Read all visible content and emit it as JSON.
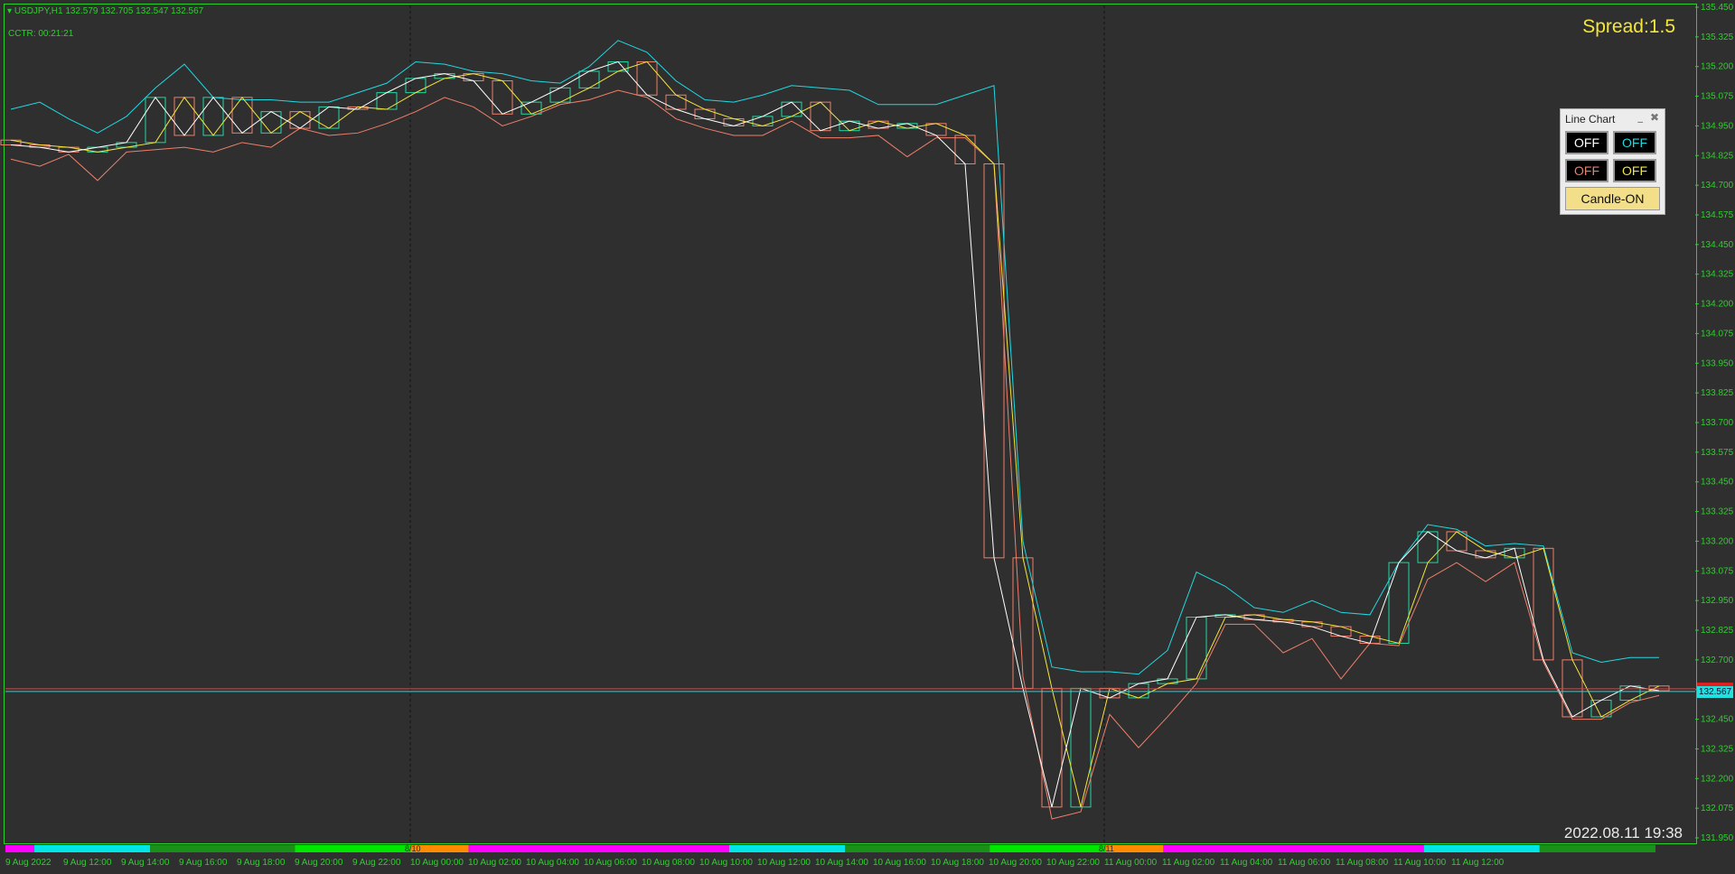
{
  "header": {
    "symbol_line": "USDJPY,H1  132.579 132.705 132.547 132.567",
    "timer": "CCTR: 00:21:21"
  },
  "spread": "Spread:1.5",
  "datetime": "2022.08.11 19:38",
  "bid_tag": "132.567",
  "panel": {
    "title": "Line Chart",
    "minimize": "_",
    "close": "✖",
    "buttons": [
      {
        "label": "OFF",
        "color": "#ffffff"
      },
      {
        "label": "OFF",
        "color": "#22d8e0"
      },
      {
        "label": "OFF",
        "color": "#ef7f6a"
      },
      {
        "label": "OFF",
        "color": "#f5e63c"
      }
    ],
    "candle_button": "Candle-ON"
  },
  "price_axis": [
    "135.450",
    "135.325",
    "135.200",
    "135.075",
    "134.950",
    "134.825",
    "134.700",
    "134.575",
    "134.450",
    "134.325",
    "134.200",
    "134.075",
    "133.950",
    "133.825",
    "133.700",
    "133.575",
    "133.450",
    "133.325",
    "133.200",
    "133.075",
    "132.950",
    "132.825",
    "132.700",
    "132.575",
    "132.450",
    "132.325",
    "132.200",
    "132.075",
    "131.950"
  ],
  "time_axis": [
    "9 Aug 2022",
    "9 Aug 12:00",
    "9 Aug 14:00",
    "9 Aug 16:00",
    "9 Aug 18:00",
    "9 Aug 20:00",
    "9 Aug 22:00",
    "10 Aug 00:00",
    "10 Aug 02:00",
    "10 Aug 04:00",
    "10 Aug 06:00",
    "10 Aug 08:00",
    "10 Aug 10:00",
    "10 Aug 12:00",
    "10 Aug 14:00",
    "10 Aug 16:00",
    "10 Aug 18:00",
    "10 Aug 20:00",
    "10 Aug 22:00",
    "11 Aug 00:00",
    "11 Aug 02:00",
    "11 Aug 04:00",
    "11 Aug 06:00",
    "11 Aug 08:00",
    "11 Aug 10:00",
    "11 Aug 12:00"
  ],
  "session_bar": {
    "day_labels": [
      "8/10",
      "8/11"
    ],
    "segments": [
      {
        "color": "#ff00ff",
        "weight": 1
      },
      {
        "color": "#00e5e5",
        "weight": 4
      },
      {
        "color": "#1a8f1a",
        "weight": 5
      },
      {
        "color": "#00e600",
        "weight": 4
      },
      {
        "color": "#ff8c00",
        "weight": 2
      },
      {
        "color": "#ff00ff",
        "weight": 9
      },
      {
        "color": "#00e5e5",
        "weight": 4
      },
      {
        "color": "#1a8f1a",
        "weight": 5
      },
      {
        "color": "#00e600",
        "weight": 4
      },
      {
        "color": "#ff8c00",
        "weight": 2
      },
      {
        "color": "#ff00ff",
        "weight": 9
      },
      {
        "color": "#00e5e5",
        "weight": 4
      },
      {
        "color": "#1a8f1a",
        "weight": 4
      }
    ]
  },
  "colors": {
    "high_line": "#22d8e0",
    "low_line": "#ef7f6a",
    "close_line": "#ffffff",
    "open_line": "#f5e63c",
    "bull_candle": "#22d8a0",
    "bear_candle": "#ef7f6a",
    "grid": "#2bd12b"
  },
  "chart_data": {
    "type": "candlestick",
    "symbol": "USDJPY",
    "timeframe": "H1",
    "ylim": [
      131.95,
      135.45
    ],
    "bid": 132.567,
    "candles": [
      {
        "o": 134.89,
        "h": 135.02,
        "l": 134.81,
        "c": 134.87
      },
      {
        "o": 134.87,
        "h": 135.05,
        "l": 134.78,
        "c": 134.86
      },
      {
        "o": 134.86,
        "h": 134.98,
        "l": 134.83,
        "c": 134.84
      },
      {
        "o": 134.84,
        "h": 134.92,
        "l": 134.72,
        "c": 134.86
      },
      {
        "o": 134.86,
        "h": 134.99,
        "l": 134.84,
        "c": 134.88
      },
      {
        "o": 134.88,
        "h": 135.11,
        "l": 134.85,
        "c": 135.07
      },
      {
        "o": 135.07,
        "h": 135.21,
        "l": 134.86,
        "c": 134.91
      },
      {
        "o": 134.91,
        "h": 135.07,
        "l": 134.84,
        "c": 135.07
      },
      {
        "o": 135.07,
        "h": 135.06,
        "l": 134.88,
        "c": 134.92
      },
      {
        "o": 134.92,
        "h": 135.06,
        "l": 134.86,
        "c": 135.01
      },
      {
        "o": 135.01,
        "h": 135.05,
        "l": 134.94,
        "c": 134.94
      },
      {
        "o": 134.94,
        "h": 135.05,
        "l": 134.91,
        "c": 135.03
      },
      {
        "o": 135.03,
        "h": 135.09,
        "l": 134.92,
        "c": 135.02
      },
      {
        "o": 135.02,
        "h": 135.13,
        "l": 134.96,
        "c": 135.09
      },
      {
        "o": 135.09,
        "h": 135.22,
        "l": 135.01,
        "c": 135.15
      },
      {
        "o": 135.15,
        "h": 135.21,
        "l": 135.07,
        "c": 135.17
      },
      {
        "o": 135.17,
        "h": 135.18,
        "l": 135.03,
        "c": 135.14
      },
      {
        "o": 135.14,
        "h": 135.17,
        "l": 134.95,
        "c": 135.0
      },
      {
        "o": 135.0,
        "h": 135.14,
        "l": 134.99,
        "c": 135.05
      },
      {
        "o": 135.05,
        "h": 135.13,
        "l": 135.04,
        "c": 135.11
      },
      {
        "o": 135.11,
        "h": 135.2,
        "l": 135.06,
        "c": 135.18
      },
      {
        "o": 135.18,
        "h": 135.31,
        "l": 135.1,
        "c": 135.22
      },
      {
        "o": 135.22,
        "h": 135.26,
        "l": 135.07,
        "c": 135.08
      },
      {
        "o": 135.08,
        "h": 135.14,
        "l": 134.98,
        "c": 135.02
      },
      {
        "o": 135.02,
        "h": 135.06,
        "l": 134.94,
        "c": 134.98
      },
      {
        "o": 134.98,
        "h": 135.05,
        "l": 134.91,
        "c": 134.95
      },
      {
        "o": 134.95,
        "h": 135.08,
        "l": 134.91,
        "c": 134.99
      },
      {
        "o": 134.99,
        "h": 135.12,
        "l": 134.97,
        "c": 135.05
      },
      {
        "o": 135.05,
        "h": 135.11,
        "l": 134.9,
        "c": 134.93
      },
      {
        "o": 134.93,
        "h": 135.1,
        "l": 134.9,
        "c": 134.97
      },
      {
        "o": 134.97,
        "h": 135.04,
        "l": 134.91,
        "c": 134.94
      },
      {
        "o": 134.94,
        "h": 135.04,
        "l": 134.82,
        "c": 134.96
      },
      {
        "o": 134.96,
        "h": 135.04,
        "l": 134.9,
        "c": 134.91
      },
      {
        "o": 134.91,
        "h": 135.08,
        "l": 134.9,
        "c": 134.79
      },
      {
        "o": 134.79,
        "h": 135.12,
        "l": 134.79,
        "c": 133.13
      },
      {
        "o": 133.13,
        "h": 133.2,
        "l": 132.63,
        "c": 132.58
      },
      {
        "o": 132.58,
        "h": 132.67,
        "l": 132.03,
        "c": 132.08
      },
      {
        "o": 132.08,
        "h": 132.65,
        "l": 132.06,
        "c": 132.58
      },
      {
        "o": 132.58,
        "h": 132.65,
        "l": 132.47,
        "c": 132.54
      },
      {
        "o": 132.54,
        "h": 132.64,
        "l": 132.33,
        "c": 132.6
      },
      {
        "o": 132.6,
        "h": 132.74,
        "l": 132.46,
        "c": 132.62
      },
      {
        "o": 132.62,
        "h": 133.07,
        "l": 132.6,
        "c": 132.88
      },
      {
        "o": 132.88,
        "h": 133.01,
        "l": 132.85,
        "c": 132.89
      },
      {
        "o": 132.89,
        "h": 132.92,
        "l": 132.85,
        "c": 132.87
      },
      {
        "o": 132.87,
        "h": 132.9,
        "l": 132.73,
        "c": 132.86
      },
      {
        "o": 132.86,
        "h": 132.95,
        "l": 132.79,
        "c": 132.84
      },
      {
        "o": 132.84,
        "h": 132.9,
        "l": 132.62,
        "c": 132.8
      },
      {
        "o": 132.8,
        "h": 132.89,
        "l": 132.77,
        "c": 132.77
      },
      {
        "o": 132.77,
        "h": 133.11,
        "l": 132.76,
        "c": 133.11
      },
      {
        "o": 133.11,
        "h": 133.27,
        "l": 133.04,
        "c": 133.24
      },
      {
        "o": 133.24,
        "h": 133.25,
        "l": 133.11,
        "c": 133.16
      },
      {
        "o": 133.16,
        "h": 133.18,
        "l": 133.03,
        "c": 133.13
      },
      {
        "o": 133.13,
        "h": 133.19,
        "l": 133.11,
        "c": 133.17
      },
      {
        "o": 133.17,
        "h": 133.18,
        "l": 132.69,
        "c": 132.7
      },
      {
        "o": 132.7,
        "h": 132.73,
        "l": 132.45,
        "c": 132.46
      },
      {
        "o": 132.46,
        "h": 132.69,
        "l": 132.45,
        "c": 132.53
      },
      {
        "o": 132.53,
        "h": 132.71,
        "l": 132.52,
        "c": 132.59
      },
      {
        "o": 132.59,
        "h": 132.71,
        "l": 132.55,
        "c": 132.57
      }
    ]
  }
}
